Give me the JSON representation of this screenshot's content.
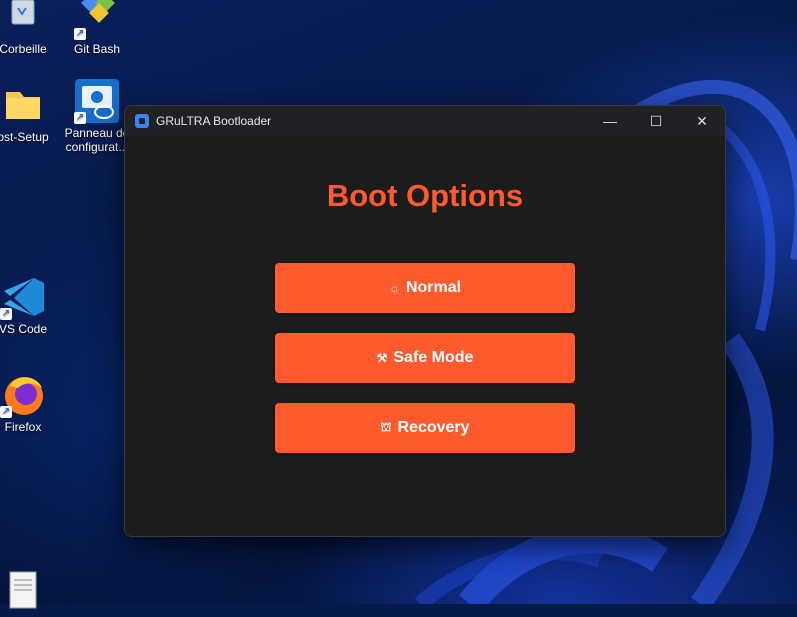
{
  "desktop": {
    "icons": [
      {
        "label": "Corbeille",
        "icon": "recycle-bin-icon"
      },
      {
        "label": "Git Bash",
        "icon": "git-bash-icon"
      },
      {
        "label": "ost-Setup",
        "icon": "folder-icon"
      },
      {
        "label": "Panneau de configurat...",
        "icon": "intel-control-panel-icon"
      },
      {
        "label": "VS Code",
        "icon": "vscode-icon"
      },
      {
        "label": "Firefox",
        "icon": "firefox-icon"
      }
    ]
  },
  "window": {
    "title": "GRuLTRA Bootloader",
    "minimize_glyph": "—",
    "maximize_glyph": "☐",
    "close_glyph": "✕"
  },
  "content": {
    "heading": "Boot Options",
    "buttons": [
      {
        "label": "Normal",
        "glyph": "☼",
        "icon": "sun-icon"
      },
      {
        "label": "Safe Mode",
        "glyph": "⚒",
        "icon": "tools-icon"
      },
      {
        "label": "Recovery",
        "glyph": "⛫",
        "icon": "recovery-icon"
      }
    ]
  },
  "colors": {
    "accent": "#ff5a2e",
    "window_bg": "#1c1c1c",
    "titlebar_bg": "#1f2124"
  }
}
